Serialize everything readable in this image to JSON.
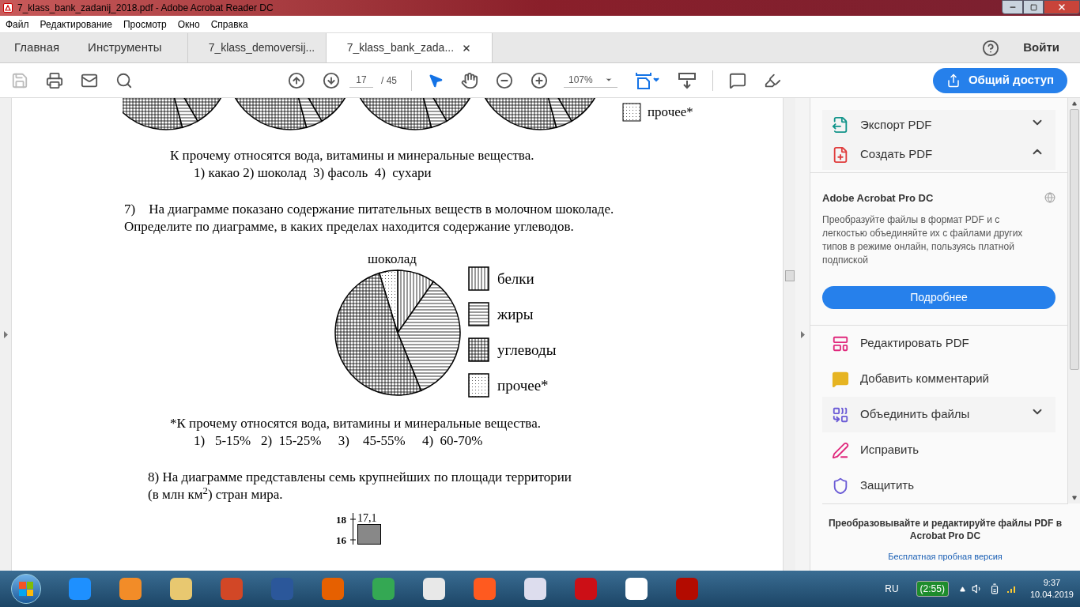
{
  "window": {
    "title": "7_klass_bank_zadanij_2018.pdf - Adobe Acrobat Reader DC"
  },
  "menu": [
    "Файл",
    "Редактирование",
    "Просмотр",
    "Окно",
    "Справка"
  ],
  "tabs": [
    {
      "label": "Главная",
      "kind": "nav",
      "selected": false
    },
    {
      "label": "Инструменты",
      "kind": "nav",
      "selected": false
    },
    {
      "label": "7_klass_demoversij...",
      "kind": "doc",
      "selected": false
    },
    {
      "label": "7_klass_bank_zada...",
      "kind": "doc",
      "selected": true
    }
  ],
  "sign_in": "Войти",
  "toolbar": {
    "page": "17",
    "total": "/ 45",
    "zoom": "107%",
    "share": "Общий доступ"
  },
  "document": {
    "top_legend": "прочее*",
    "note_1": "К прочему относятся вода, витамины и минеральные вещества.",
    "answers_1": "1) какао 2) шоколад  3) фасоль  4)  сухари",
    "question_7": [
      "7)    На диаграмме показано содержание питательных веществ в молочном шоколаде.",
      "Определите по диаграмме, в каких пределах находится содержание углеводов."
    ],
    "pie_title": "шоколад",
    "legend": [
      {
        "label": "белки",
        "kind": "vertical"
      },
      {
        "label": "жиры",
        "kind": "horizontal"
      },
      {
        "label": "углеводы",
        "kind": "grid"
      },
      {
        "label": "прочее*",
        "kind": "dots"
      }
    ],
    "note_2": "*К прочему относятся вода, витамины и минеральные вещества.",
    "answers_2": "1)   5-15%   2)  15-25%     3)    45-55%     4)  60-70%",
    "question_8": [
      "8) На диаграмме представлены семь крупнейших по площади территории",
      "(в млн км$^{2}$) стран мира."
    ],
    "bar_chart_fragment": {
      "ticks": [
        "18",
        "16"
      ],
      "bar_label": "17,1"
    }
  },
  "tools_panel": {
    "items": [
      {
        "label": "Экспорт PDF",
        "kind": "expandable",
        "expanded": false
      },
      {
        "label": "Создать PDF",
        "kind": "expandable",
        "expanded": true
      }
    ],
    "promo": {
      "title": "Adobe Acrobat Pro DC",
      "text": "Преобразуйте файлы в формат PDF и с легкостью объединяйте их с файлами других типов в режиме онлайн, пользуясь платной подпиской",
      "button": "Подробнее"
    },
    "tools": [
      {
        "label": "Редактировать PDF",
        "kind": "plain"
      },
      {
        "label": "Добавить комментарий",
        "kind": "plain"
      },
      {
        "label": "Объединить файлы",
        "kind": "expandable",
        "expanded": false
      },
      {
        "label": "Исправить",
        "kind": "plain"
      },
      {
        "label": "Защитить",
        "kind": "plain"
      }
    ],
    "footer": {
      "text": "Преобразовывайте и редактируйте файлы PDF в Acrobat Pro DC",
      "link": "Бесплатная пробная версия"
    }
  },
  "taskbar": {
    "language": "RU",
    "battery": "(2:55)",
    "time": "9:37",
    "date": "10.04.2019"
  }
}
